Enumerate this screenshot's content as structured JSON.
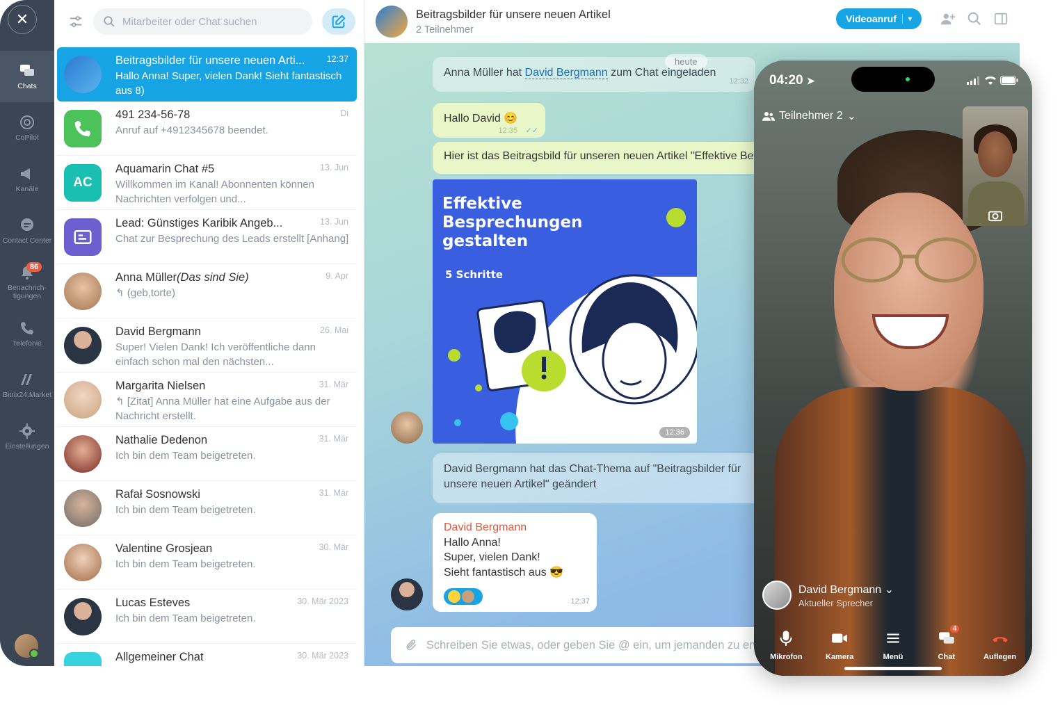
{
  "rail": {
    "items": [
      {
        "label": "Chats"
      },
      {
        "label": "CoPilot"
      },
      {
        "label": "Kanäle"
      },
      {
        "label": "Contact Center"
      },
      {
        "label": "Benachrich-\ntigungen",
        "badge": "86"
      },
      {
        "label": "Telefonie"
      },
      {
        "label": "Bitrix24.Market"
      },
      {
        "label": "Einstellungen"
      }
    ]
  },
  "search": {
    "placeholder": "Mitarbeiter oder Chat suchen"
  },
  "chats": [
    {
      "name": "Beitragsbilder für unsere neuen Arti...",
      "time": "12:37",
      "preview": "Hallo Anna! Super, vielen Dank! Sieht fantastisch aus 8)"
    },
    {
      "name": "491 234-56-78",
      "time": "Di",
      "preview": "Anruf auf +4912345678 beendet."
    },
    {
      "name": "Aquamarin Chat #5",
      "time": "13. Jun",
      "preview": "Willkommen im Kanal! Abonnenten können Nachrichten verfolgen und...",
      "initials": "AC"
    },
    {
      "name": "Lead: Günstiges Karibik Angeb...",
      "time": "13. Jun",
      "preview": "Chat zur Besprechung des Leads erstellt [Anhang]"
    },
    {
      "name": "Anna Müller",
      "name_suffix": "(Das sind Sie)",
      "time": "9. Apr",
      "preview": "↰ (geb,torte)"
    },
    {
      "name": "David Bergmann",
      "time": "26. Mai",
      "preview": "Super! Vielen Dank! Ich veröffentliche dann einfach schon mal den nächsten..."
    },
    {
      "name": "Margarita Nielsen",
      "time": "31. Mär",
      "preview": "↰ [Zitat] Anna Müller hat eine Aufgabe aus der Nachricht erstellt."
    },
    {
      "name": "Nathalie Dedenon",
      "time": "31. Mär",
      "preview": "Ich bin dem Team beigetreten."
    },
    {
      "name": "Rafał Sosnowski",
      "time": "31. Mär",
      "preview": "Ich bin dem Team beigetreten."
    },
    {
      "name": "Valentine Grosjean",
      "time": "30. Mär",
      "preview": "Ich bin dem Team beigetreten."
    },
    {
      "name": "Lucas Esteves",
      "time": "30. Mär 2023",
      "preview": "Ich bin dem Team beigetreten."
    },
    {
      "name": "Allgemeiner Chat",
      "time": "30. Mär 2023",
      "preview": ""
    }
  ],
  "header": {
    "title": "Beitragsbilder für unsere neuen Artikel",
    "subtitle": "2 Teilnehmer",
    "video_button": "Videoanruf"
  },
  "messages": {
    "date": "heute",
    "sys1_prefix": "Anna Müller hat ",
    "sys1_link": "David Bergmann",
    "sys1_suffix": " zum Chat eingeladen",
    "sys1_time": "12:32",
    "hello": "Hallo David 😊",
    "hello_time": "12:35",
    "article": "Hier ist das Beitragsbild für unseren neuen Artikel \"Effektive Besprechungen gestalten\"",
    "image_title": "Effektive Besprechungen gestalten",
    "image_sub": "5 Schritte",
    "image_time": "12:36",
    "topic": "David Bergmann hat das Chat-Thema auf \"Beitragsbilder für unsere neuen Artikel\" geändert",
    "reply_name": "David Bergmann",
    "reply_l1": "Hallo Anna!",
    "reply_l2": "Super, vielen Dank!",
    "reply_l3": "Sieht fantastisch aus 😎",
    "reply_time": "12:37"
  },
  "composer": {
    "placeholder": "Schreiben Sie etwas, oder geben Sie @ ein, um jemanden zu erwähnen"
  },
  "phone": {
    "time": "04:20",
    "participants": "Teilnehmer 2",
    "speaker_name": "David Bergmann",
    "speaker_role": "Aktueller Sprecher",
    "controls": [
      {
        "label": "Mikrofon"
      },
      {
        "label": "Kamera"
      },
      {
        "label": "Menü"
      },
      {
        "label": "Chat",
        "badge": "4"
      },
      {
        "label": "Auflegen"
      }
    ]
  },
  "colors": {
    "accent": "#17a4e4",
    "rail": "#3b4554",
    "badge": "#f15a3e",
    "hangup": "#f15a3e"
  }
}
